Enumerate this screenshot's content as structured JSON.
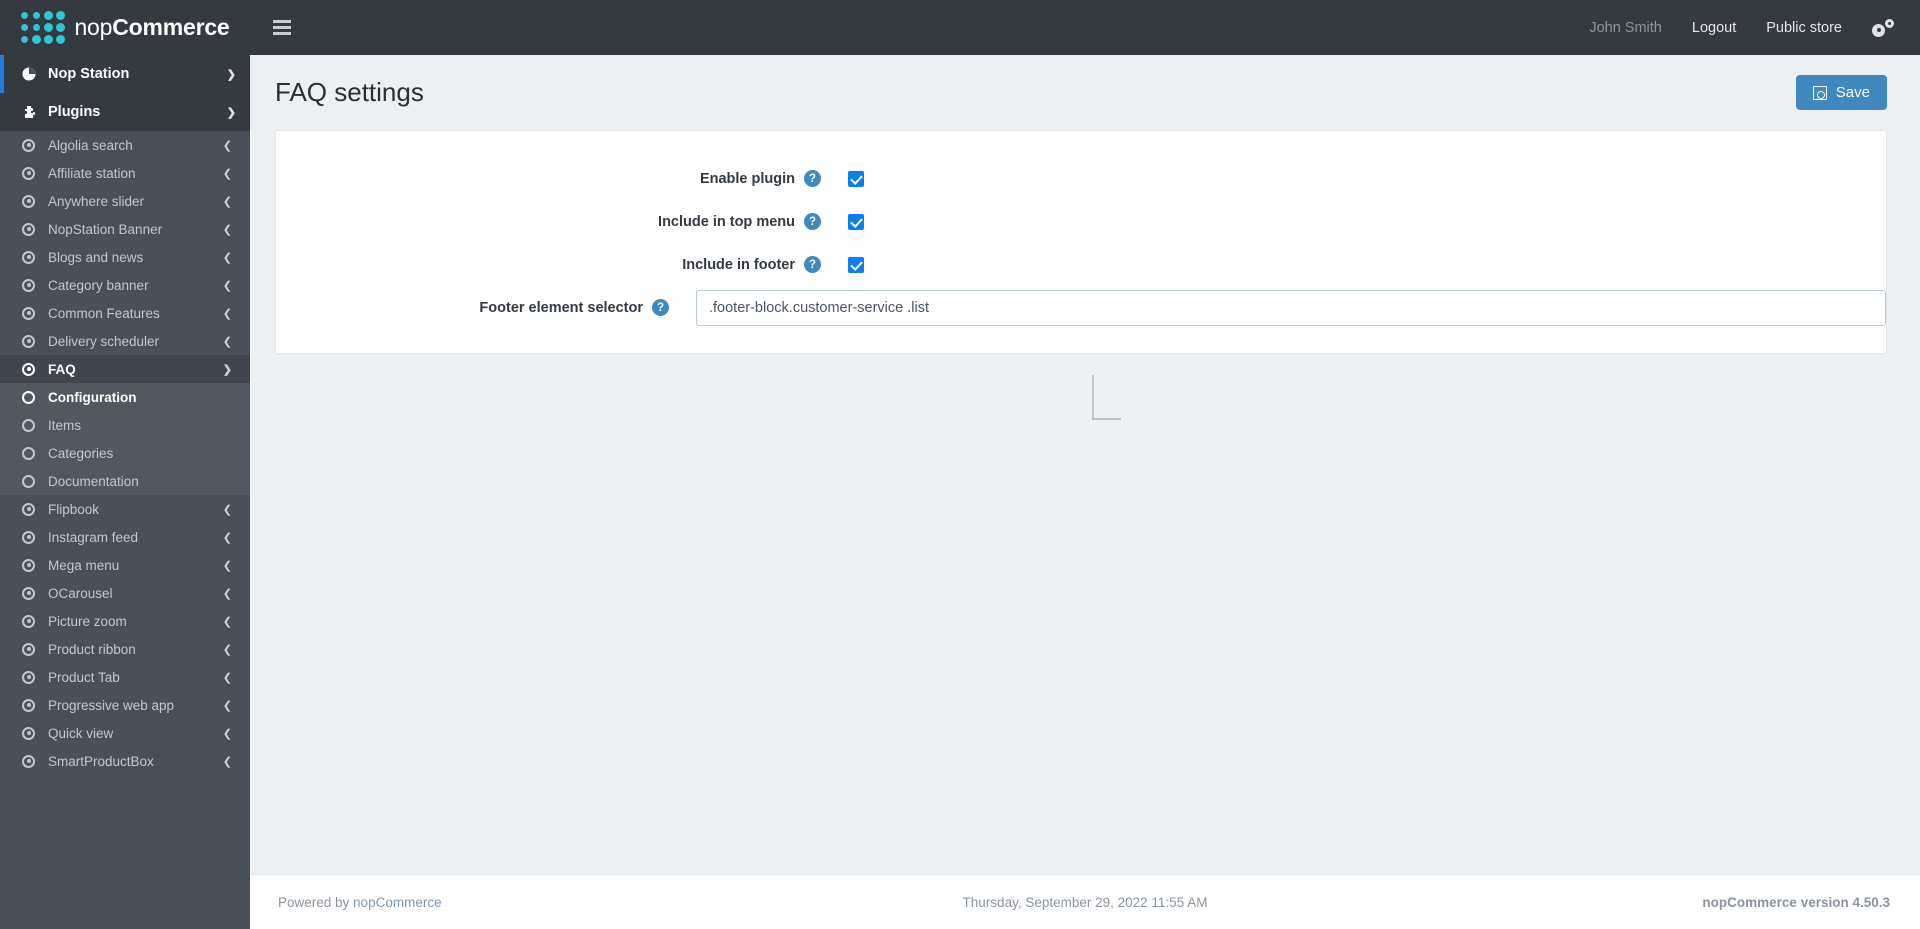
{
  "brand": {
    "name_light": "nop",
    "name_bold": "Commerce",
    "logo_icon": "nopcommerce-dots-logo"
  },
  "header": {
    "menu_toggle_icon": "hamburger-icon",
    "user_name": "John Smith",
    "logout_label": "Logout",
    "public_store_label": "Public store",
    "settings_icon": "gears-icon"
  },
  "sidebar": {
    "top_items": [
      {
        "label": "Nop Station",
        "icon": "pie-chart-icon",
        "chevron": "chevron-down-icon",
        "accent": true
      },
      {
        "label": "Plugins",
        "icon": "puzzle-piece-icon",
        "chevron": "chevron-down-icon",
        "accent": false
      }
    ],
    "items": [
      {
        "label": "Algolia search",
        "icon": "dot-circle-icon",
        "chevron": "chevron-left-icon"
      },
      {
        "label": "Affiliate station",
        "icon": "dot-circle-icon",
        "chevron": "chevron-left-icon"
      },
      {
        "label": "Anywhere slider",
        "icon": "dot-circle-icon",
        "chevron": "chevron-left-icon"
      },
      {
        "label": "NopStation Banner",
        "icon": "dot-circle-icon",
        "chevron": "chevron-left-icon"
      },
      {
        "label": "Blogs and news",
        "icon": "dot-circle-icon",
        "chevron": "chevron-left-icon"
      },
      {
        "label": "Category banner",
        "icon": "dot-circle-icon",
        "chevron": "chevron-left-icon"
      },
      {
        "label": "Common Features",
        "icon": "dot-circle-icon",
        "chevron": "chevron-left-icon"
      },
      {
        "label": "Delivery scheduler",
        "icon": "dot-circle-icon",
        "chevron": "chevron-left-icon"
      }
    ],
    "faq": {
      "label": "FAQ",
      "icon": "dot-circle-icon",
      "chevron": "chevron-down-icon"
    },
    "faq_children": [
      {
        "label": "Configuration",
        "icon": "circle-icon",
        "current": true
      },
      {
        "label": "Items",
        "icon": "circle-icon",
        "current": false
      },
      {
        "label": "Categories",
        "icon": "circle-icon",
        "current": false
      },
      {
        "label": "Documentation",
        "icon": "circle-icon",
        "current": false
      }
    ],
    "items_after": [
      {
        "label": "Flipbook",
        "icon": "dot-circle-icon",
        "chevron": "chevron-left-icon"
      },
      {
        "label": "Instagram feed",
        "icon": "dot-circle-icon",
        "chevron": "chevron-left-icon"
      },
      {
        "label": "Mega menu",
        "icon": "dot-circle-icon",
        "chevron": "chevron-left-icon"
      },
      {
        "label": "OCarousel",
        "icon": "dot-circle-icon",
        "chevron": "chevron-left-icon"
      },
      {
        "label": "Picture zoom",
        "icon": "dot-circle-icon",
        "chevron": "chevron-left-icon"
      },
      {
        "label": "Product ribbon",
        "icon": "dot-circle-icon",
        "chevron": "chevron-left-icon"
      },
      {
        "label": "Product Tab",
        "icon": "dot-circle-icon",
        "chevron": "chevron-left-icon"
      },
      {
        "label": "Progressive web app",
        "icon": "dot-circle-icon",
        "chevron": "chevron-left-icon"
      },
      {
        "label": "Quick view",
        "icon": "dot-circle-icon",
        "chevron": "chevron-left-icon"
      },
      {
        "label": "SmartProductBox",
        "icon": "dot-circle-icon",
        "chevron": "chevron-left-icon"
      }
    ]
  },
  "page": {
    "title": "FAQ settings",
    "save_label": "Save",
    "save_icon": "floppy-disk-icon"
  },
  "form": {
    "help_icon": "question-mark-icon",
    "rows": [
      {
        "label": "Enable plugin",
        "type": "checkbox",
        "checked": true
      },
      {
        "label": "Include in top menu",
        "type": "checkbox",
        "checked": true
      },
      {
        "label": "Include in footer",
        "type": "checkbox",
        "checked": true
      },
      {
        "label": "Footer element selector",
        "type": "text",
        "value": ".footer-block.customer-service .list",
        "placeholder": ""
      }
    ]
  },
  "footer": {
    "powered_by_prefix": "Powered by ",
    "powered_by_link": "nopCommerce",
    "datetime": "Thursday, September 29, 2022 11:55 AM",
    "version": "nopCommerce version 4.50.3"
  },
  "colors": {
    "sidebar_bg": "#4a5059",
    "header_bg": "#343a40",
    "accent_blue": "#1f7fe0",
    "brand_teal": "#2cc6d6",
    "button_blue": "#3f89c0",
    "checkbox_blue": "#0d7ef0",
    "page_bg": "#ecf0f3"
  }
}
